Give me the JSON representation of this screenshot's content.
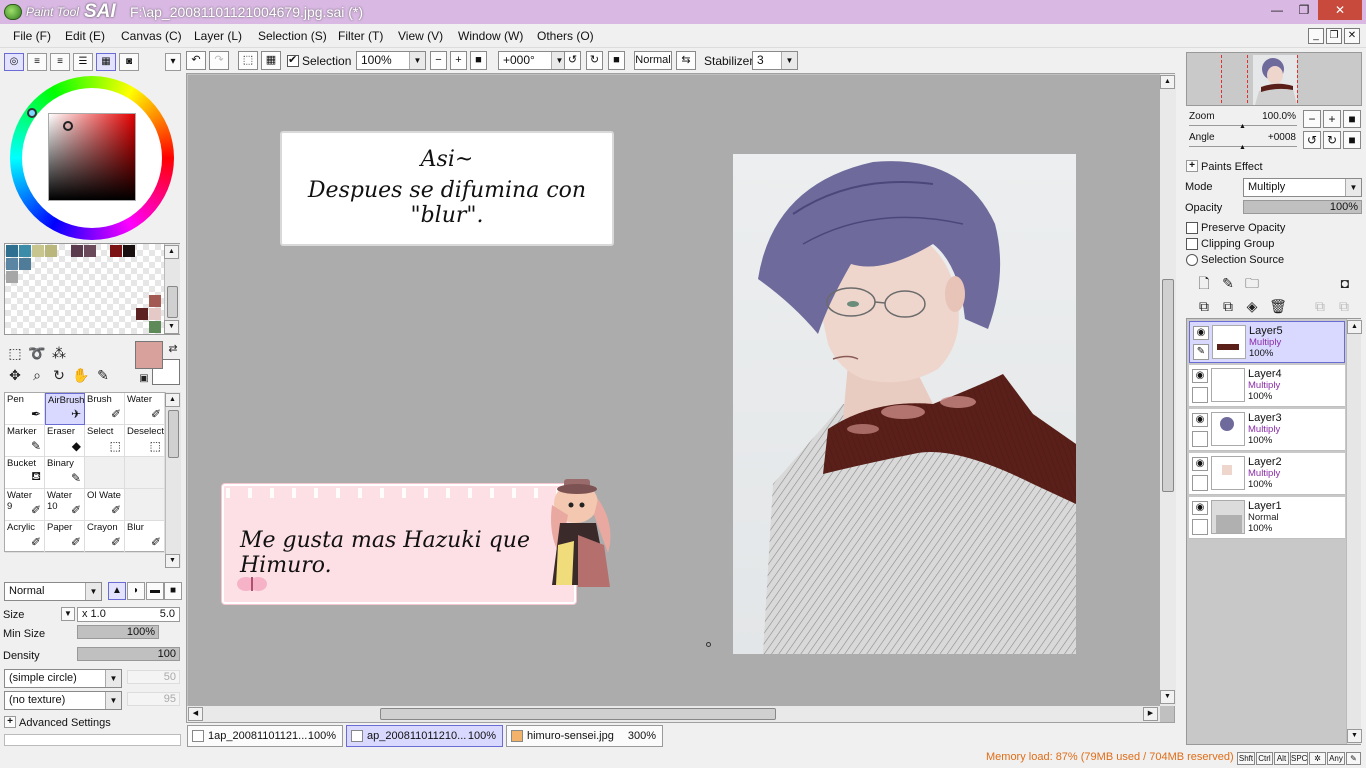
{
  "window": {
    "app_name_small": "Paint Tool",
    "app_name_big": "SAI",
    "title": "F:\\ap_20081101121004679.jpg.sai (*)"
  },
  "menu": [
    {
      "label": "File (F)"
    },
    {
      "label": "Edit (E)"
    },
    {
      "label": "Canvas (C)"
    },
    {
      "label": "Layer (L)"
    },
    {
      "label": "Selection (S)"
    },
    {
      "label": "Filter (T)"
    },
    {
      "label": "View (V)"
    },
    {
      "label": "Window (W)"
    },
    {
      "label": "Others (O)"
    }
  ],
  "toolbar": {
    "selection_label": "Selection",
    "zoom": "100%",
    "rotation": "+000°",
    "mode": "Normal",
    "stabilizer_label": "Stabilizer",
    "stabilizer_value": "3"
  },
  "brushes": [
    {
      "name": "Pen",
      "sub": ""
    },
    {
      "name": "AirBrush",
      "sub": ""
    },
    {
      "name": "Brush",
      "sub": ""
    },
    {
      "name": "Water",
      "sub": ""
    },
    {
      "name": "Marker",
      "sub": ""
    },
    {
      "name": "Eraser",
      "sub": ""
    },
    {
      "name": "Select",
      "sub": ""
    },
    {
      "name": "Deselect",
      "sub": ""
    },
    {
      "name": "Bucket",
      "sub": ""
    },
    {
      "name": "Binary",
      "sub": ""
    },
    {
      "name": "",
      "sub": ""
    },
    {
      "name": "",
      "sub": ""
    },
    {
      "name": "Water",
      "sub": "9"
    },
    {
      "name": "Water",
      "sub": "10"
    },
    {
      "name": "Ol Wate",
      "sub": ""
    },
    {
      "name": "",
      "sub": ""
    },
    {
      "name": "Acrylic",
      "sub": ""
    },
    {
      "name": "Paper",
      "sub": ""
    },
    {
      "name": "Crayon",
      "sub": ""
    },
    {
      "name": "Blur",
      "sub": ""
    }
  ],
  "brush_settings": {
    "blend_mode": "Normal",
    "size_label": "Size",
    "size_mult": "x 1.0",
    "size_value": "5.0",
    "minsize_label": "Min Size",
    "minsize_value": "100%",
    "density_label": "Density",
    "density_value": "100",
    "shape": "(simple circle)",
    "shape_value": "50",
    "texture": "(no texture)",
    "texture_value": "95",
    "advanced_label": "Advanced Settings"
  },
  "canvas": {
    "bubble1_line1": "Asi~",
    "bubble1_line2": "Despues se difumina con \"blur\".",
    "bubble2_text": "Me gusta mas Hazuki que Himuro."
  },
  "tabs": [
    {
      "label": "1ap_20081101121...",
      "zoom": "100%"
    },
    {
      "label": "ap_200811011210...",
      "zoom": "100%"
    },
    {
      "label": "himuro-sensei.jpg",
      "zoom": "300%"
    }
  ],
  "status": {
    "memory": "Memory load: 87% (79MB used / 704MB reserved)",
    "keys": [
      "Shft",
      "Ctrl",
      "Alt",
      "SPC",
      "Any"
    ]
  },
  "navigator": {
    "zoom_label": "Zoom",
    "zoom_value": "100.0%",
    "angle_label": "Angle",
    "angle_value": "+0008"
  },
  "layer_props": {
    "paints_effect_label": "Paints Effect",
    "mode_label": "Mode",
    "mode_value": "Multiply",
    "opacity_label": "Opacity",
    "opacity_value": "100%",
    "preserve_opacity": "Preserve Opacity",
    "clipping_group": "Clipping Group",
    "selection_source": "Selection Source"
  },
  "layers": [
    {
      "name": "Layer5",
      "mode": "Multiply",
      "opacity": "100%",
      "selected": true
    },
    {
      "name": "Layer4",
      "mode": "Multiply",
      "opacity": "100%"
    },
    {
      "name": "Layer3",
      "mode": "Multiply",
      "opacity": "100%"
    },
    {
      "name": "Layer2",
      "mode": "Multiply",
      "opacity": "100%"
    },
    {
      "name": "Layer1",
      "mode": "Normal",
      "opacity": "100%"
    }
  ],
  "colors": {
    "foreground": "#d8a19b",
    "accent_select": "#d9d9ff",
    "memory_text": "#e06d16"
  }
}
